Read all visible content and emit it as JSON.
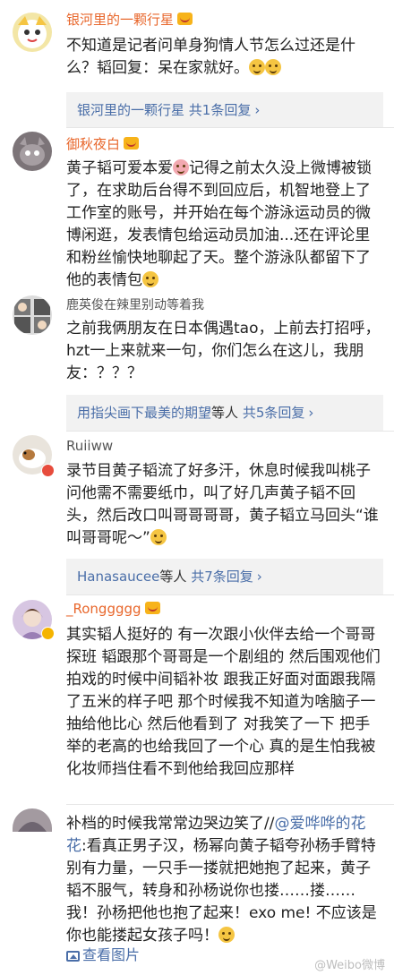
{
  "comments": [
    {
      "username": "银河里的一颗行星",
      "body": "不知道是记者问单身狗情人节怎么过还是什么？韬回复：呆在家就好。",
      "reply": {
        "who": "银河里的一颗行星",
        "count": "共1条回复",
        "chevron": "›"
      }
    },
    {
      "username": "御秋夜白",
      "body_a": "黄子韬可爱本爱",
      "body_b": "记得之前太久没上微博被锁了，在求助后台得不到回应后，机智地登上了工作室的账号，并开始在每个游泳运动员的微博闲逛，发表情包给运动员加油...还在评论里和粉丝愉快地聊起了天。整个游泳队都留下了他的表情包"
    },
    {
      "username": "鹿英俊在辣里别动等着我",
      "body": "之前我俩朋友在日本偶遇tao，上前去打招呼，hzt一上来就来一句，你们怎么在这儿，我朋友：？？？",
      "reply": {
        "who": "用指尖画下最美的期望",
        "mid": "等人",
        "count": "共5条回复",
        "chevron": "›"
      }
    },
    {
      "username": "Ruiiww",
      "body": "录节目黄子韬流了好多汗，休息时候我叫桃子问他需不需要纸巾，叫了好几声黄子韬不回头，然后改口叫哥哥哥哥，黄子韬立马回头“谁叫哥哥呢～”",
      "reply": {
        "who": "Hanasaucee",
        "mid": "等人",
        "count": "共7条回复",
        "chevron": "›"
      }
    },
    {
      "username": "_Ronggggg",
      "body": "其实韬人挺好的 有一次跟小伙伴去给一个哥哥探班 韬跟那个哥哥是一个剧组的 然后围观他们拍戏的时候中间韬补妆 跟我正好面对面跟我隔了五米的样子吧 那个时候我不知道为啥脑子一抽给他比心 然后他看到了 对我笑了一下 把手举的老高的也给我回了一个心 真的是生怕我被化妆师挡住看不到他给我回应那样"
    },
    {
      "body_a": "补档的时候我常常边哭边笑了//",
      "mention": "@爱哗哗的花花",
      "body_b": ":看真正男子汉，杨幂向黄子韬夸孙杨手臂特别有力量，一只手一搂就把她抱了起来，黄子韬不服气，转身和孙杨说你也搂……搂……我！孙杨把他也抱了起来！exo me! 不应该是你也能搂起女孩子吗！",
      "view_image": "查看图片"
    }
  ],
  "watermark": "@Weibo微博"
}
